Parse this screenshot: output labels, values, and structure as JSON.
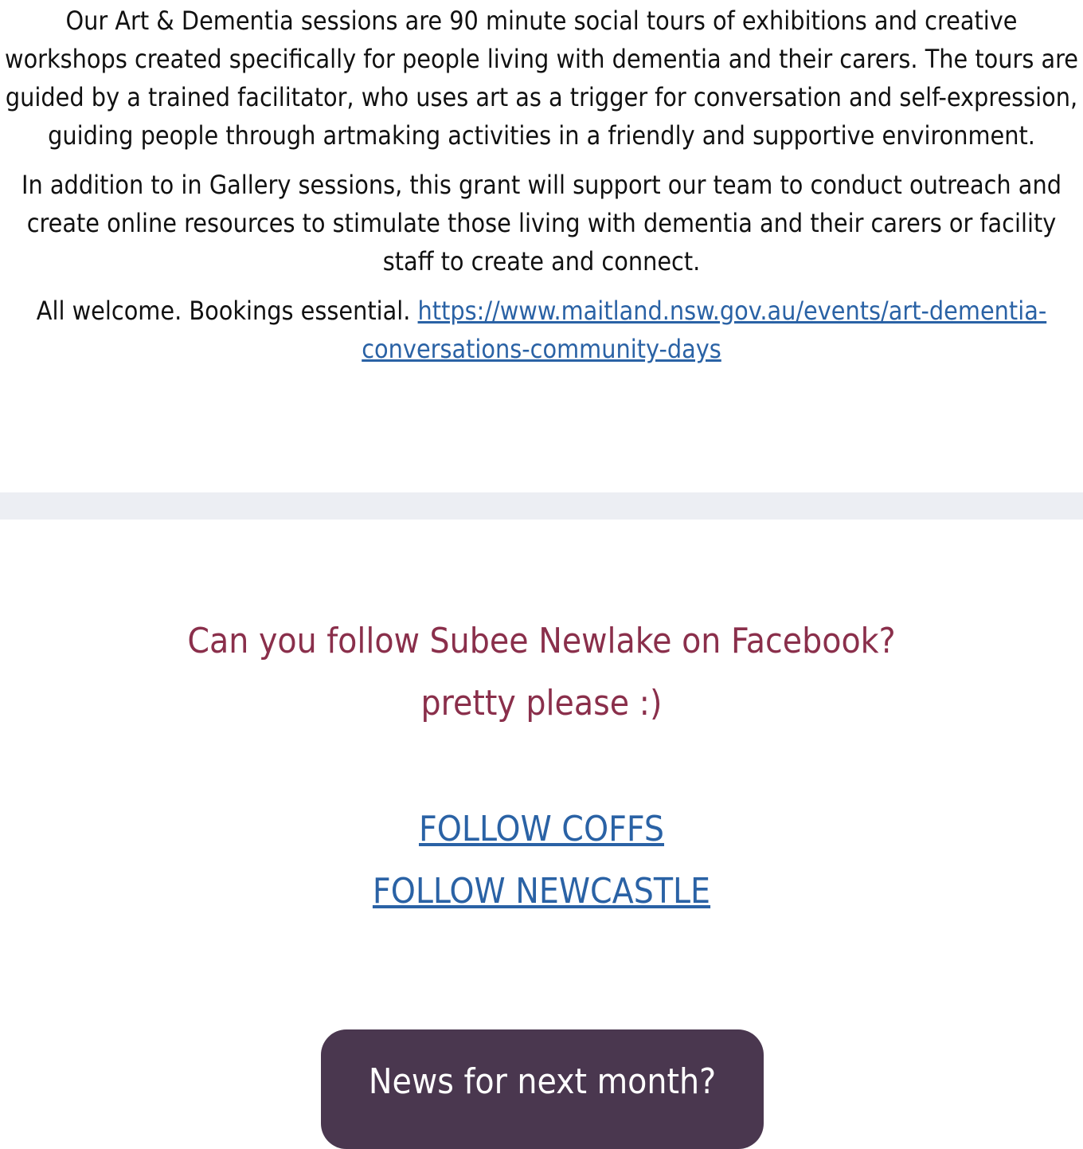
{
  "article": {
    "para1": "Our Art & Dementia sessions are 90 minute social tours of exhibitions and creative workshops created specifically for people living with dementia and their carers. The tours are guided by a trained facilitator, who uses art as a trigger for conversation and self-expression, guiding people through artmaking activities in a friendly and supportive environment.",
    "para2": "In addition to in Gallery sessions, this grant will support our team to conduct outreach and create online resources to stimulate those living with dementia and their carers or facility staff to create and connect.",
    "para3_text": "All welcome. Bookings essential.",
    "para3_link": "https://www.maitland.nsw.gov.au/events/art-dementia-conversations-community-days"
  },
  "follow": {
    "heading_line1": "Can you follow Subee Newlake on Facebook?",
    "heading_line2": "pretty please :)",
    "coffs_label": "FOLLOW COFFS",
    "newcastle_label": "FOLLOW NEWCASTLE"
  },
  "news_button_label": "News for next month?",
  "colors": {
    "link": "#2a62a5",
    "heading": "#8a2f4b",
    "button_bg": "#4a374f",
    "divider": "#eceef3"
  }
}
